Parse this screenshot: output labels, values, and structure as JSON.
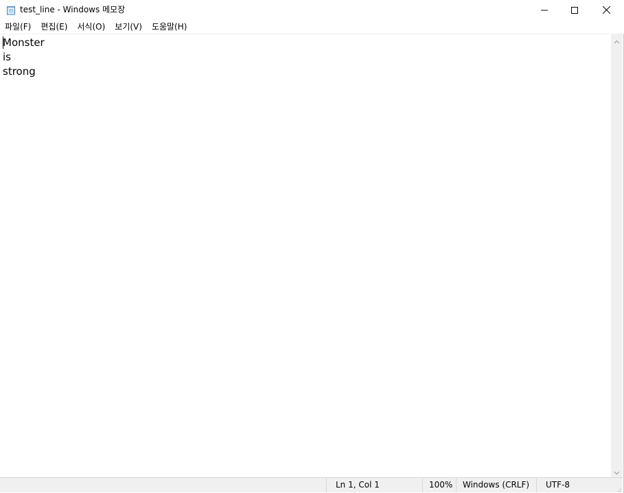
{
  "window": {
    "title": "test_line - Windows 메모장",
    "app_icon": "notepad-icon",
    "controls": {
      "minimize_icon": "minimize-icon",
      "maximize_icon": "maximize-icon",
      "close_icon": "close-icon"
    }
  },
  "menu": {
    "items": [
      {
        "label": "파일(F)"
      },
      {
        "label": "편집(E)"
      },
      {
        "label": "서식(O)"
      },
      {
        "label": "보기(V)"
      },
      {
        "label": "도움말(H)"
      }
    ]
  },
  "editor": {
    "lines": [
      "Monster",
      "is",
      "strong"
    ]
  },
  "statusbar": {
    "position": "Ln 1, Col 1",
    "zoom": "100%",
    "line_ending": "Windows (CRLF)",
    "encoding": "UTF-8"
  },
  "colors": {
    "background": "#ffffff",
    "statusbar": "#f0f0f0",
    "scrollbar": "#f0f0f0"
  }
}
